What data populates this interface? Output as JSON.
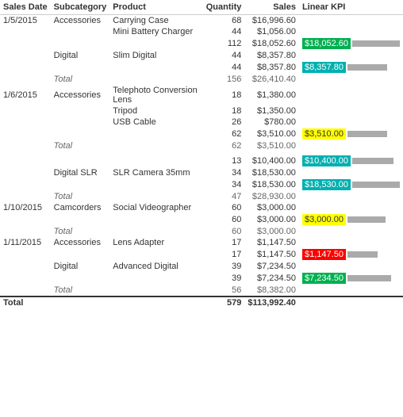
{
  "headers": [
    "Sales Date",
    "Subcategory",
    "Product",
    "Quantity",
    "Sales",
    "Linear KPI"
  ],
  "rows": [
    {
      "date": "1/5/2015",
      "subcat": "Accessories",
      "product": "Carrying Case",
      "qty": "68",
      "sales": "$16,996.60",
      "kpi": null,
      "kpiBar": 55,
      "highlight": null
    },
    {
      "date": "",
      "subcat": "",
      "product": "Mini Battery Charger",
      "qty": "44",
      "sales": "$1,056.00",
      "kpi": null,
      "kpiBar": 0,
      "highlight": null
    },
    {
      "date": "",
      "subcat": "",
      "product": "",
      "qty": "112",
      "sales": "$18,052.60",
      "kpi": "green",
      "kpiBar": 60,
      "highlight": "green"
    },
    {
      "date": "",
      "subcat": "Digital",
      "product": "Slim Digital",
      "qty": "44",
      "sales": "$8,357.80",
      "kpi": null,
      "kpiBar": 0,
      "highlight": null
    },
    {
      "date": "",
      "subcat": "",
      "product": "",
      "qty": "44",
      "sales": "$8,357.80",
      "kpi": "teal",
      "kpiBar": 50,
      "highlight": "teal"
    },
    {
      "date": "",
      "subcat": "Total",
      "product": "",
      "qty": "156",
      "sales": "$26,410.40",
      "kpi": null,
      "kpiBar": 0,
      "highlight": null
    },
    {
      "date": "1/6/2015",
      "subcat": "Accessories",
      "product": "Telephoto Conversion Lens",
      "qty": "18",
      "sales": "$1,380.00",
      "kpi": null,
      "kpiBar": 0,
      "highlight": null
    },
    {
      "date": "",
      "subcat": "",
      "product": "Tripod",
      "qty": "18",
      "sales": "$1,350.00",
      "kpi": null,
      "kpiBar": 0,
      "highlight": null
    },
    {
      "date": "",
      "subcat": "",
      "product": "USB Cable",
      "qty": "26",
      "sales": "$780.00",
      "kpi": null,
      "kpiBar": 0,
      "highlight": null
    },
    {
      "date": "",
      "subcat": "",
      "product": "",
      "qty": "62",
      "sales": "$3,510.00",
      "kpi": "yellow",
      "kpiBar": 50,
      "highlight": "yellow"
    },
    {
      "date": "",
      "subcat": "Total",
      "product": "",
      "qty": "62",
      "sales": "$3,510.00",
      "kpi": null,
      "kpiBar": 0,
      "highlight": null
    },
    {
      "date": "",
      "subcat": "",
      "product": "",
      "qty": "",
      "sales": "",
      "kpi": null,
      "kpiBar": 0,
      "highlight": null,
      "separator": true
    },
    {
      "date": "",
      "subcat": "",
      "product": "",
      "qty": "13",
      "sales": "$10,400.00",
      "kpi": "teal",
      "kpiBar": 52,
      "highlight": "teal"
    },
    {
      "date": "",
      "subcat": "Digital SLR",
      "product": "SLR Camera 35mm",
      "qty": "34",
      "sales": "$18,530.00",
      "kpi": null,
      "kpiBar": 0,
      "highlight": null
    },
    {
      "date": "",
      "subcat": "",
      "product": "",
      "qty": "34",
      "sales": "$18,530.00",
      "kpi": "teal",
      "kpiBar": 60,
      "highlight": "teal"
    },
    {
      "date": "",
      "subcat": "Total",
      "product": "",
      "qty": "47",
      "sales": "$28,930.00",
      "kpi": null,
      "kpiBar": 0,
      "highlight": null
    },
    {
      "date": "1/10/2015",
      "subcat": "Camcorders",
      "product": "Social Videographer",
      "qty": "60",
      "sales": "$3,000.00",
      "kpi": null,
      "kpiBar": 0,
      "highlight": null
    },
    {
      "date": "",
      "subcat": "",
      "product": "",
      "qty": "60",
      "sales": "$3,000.00",
      "kpi": "yellow",
      "kpiBar": 48,
      "highlight": "yellow"
    },
    {
      "date": "",
      "subcat": "Total",
      "product": "",
      "qty": "60",
      "sales": "$3,000.00",
      "kpi": null,
      "kpiBar": 0,
      "highlight": null
    },
    {
      "date": "1/11/2015",
      "subcat": "Accessories",
      "product": "Lens Adapter",
      "qty": "17",
      "sales": "$1,147.50",
      "kpi": null,
      "kpiBar": 0,
      "highlight": null
    },
    {
      "date": "",
      "subcat": "",
      "product": "",
      "qty": "17",
      "sales": "$1,147.50",
      "kpi": "red",
      "kpiBar": 38,
      "highlight": "red"
    },
    {
      "date": "",
      "subcat": "Digital",
      "product": "Advanced Digital",
      "qty": "39",
      "sales": "$7,234.50",
      "kpi": null,
      "kpiBar": 0,
      "highlight": null
    },
    {
      "date": "",
      "subcat": "",
      "product": "",
      "qty": "39",
      "sales": "$7,234.50",
      "kpi": "green",
      "kpiBar": 55,
      "highlight": "green"
    },
    {
      "date": "",
      "subcat": "Total",
      "product": "",
      "qty": "56",
      "sales": "$8,382.00",
      "kpi": null,
      "kpiBar": 0,
      "highlight": null
    }
  ],
  "grandTotal": {
    "label": "Total",
    "qty": "579",
    "sales": "$113,992.40"
  }
}
